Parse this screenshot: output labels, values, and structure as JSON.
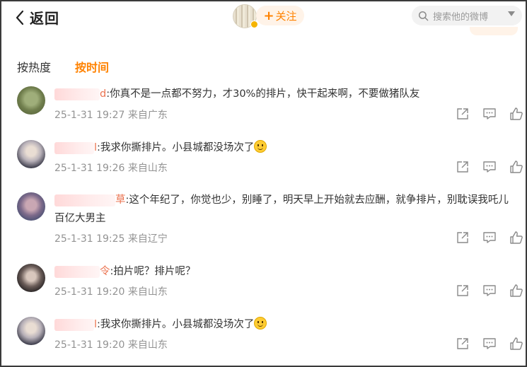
{
  "header": {
    "back_label": "返回",
    "follow_label": "关注",
    "follow_plus": "+",
    "search_placeholder": "搜索他的微博"
  },
  "sort_tabs": [
    {
      "label": "按热度",
      "active": false
    },
    {
      "label": "按时间",
      "active": true
    }
  ],
  "comments": [
    {
      "name_tail": "d",
      "text": ":你真不是一点都不努力，才30%的排片，快干起来啊，不要做猪队友",
      "has_emoji": false,
      "time": "25-1-31 19:27",
      "location": "来自广东"
    },
    {
      "name_tail": "l",
      "text": ":我求你撕排片。小县城都没场次了",
      "has_emoji": true,
      "time": "25-1-31 19:26",
      "location": "来自山东"
    },
    {
      "name_tail": "草",
      "text": ":这个年纪了，你觉也少，别睡了，明天早上开始就去应酬，就争排片，别耽误我吒儿百亿大男主",
      "has_emoji": false,
      "time": "25-1-31 19:25",
      "location": "来自辽宁"
    },
    {
      "name_tail": "令",
      "text": ":拍片呢？排片呢？",
      "has_emoji": false,
      "time": "25-1-31 19:20",
      "location": "来自山东"
    },
    {
      "name_tail": "l",
      "text": ":我求你撕排片。小县城都没场次了",
      "has_emoji": true,
      "time": "25-1-31 19:20",
      "location": "来自山东"
    }
  ],
  "icons": {
    "back": "chevron-left-icon",
    "search": "search-icon",
    "dropdown": "caret-down-icon",
    "share": "share-icon",
    "reply": "comment-icon",
    "like": "thumb-up-icon",
    "emoji": "smile-emoji-icon"
  },
  "colors": {
    "accent": "#ff8200",
    "follow_bg": "#fff3e8",
    "name": "#eb7350",
    "meta": "#939393"
  }
}
